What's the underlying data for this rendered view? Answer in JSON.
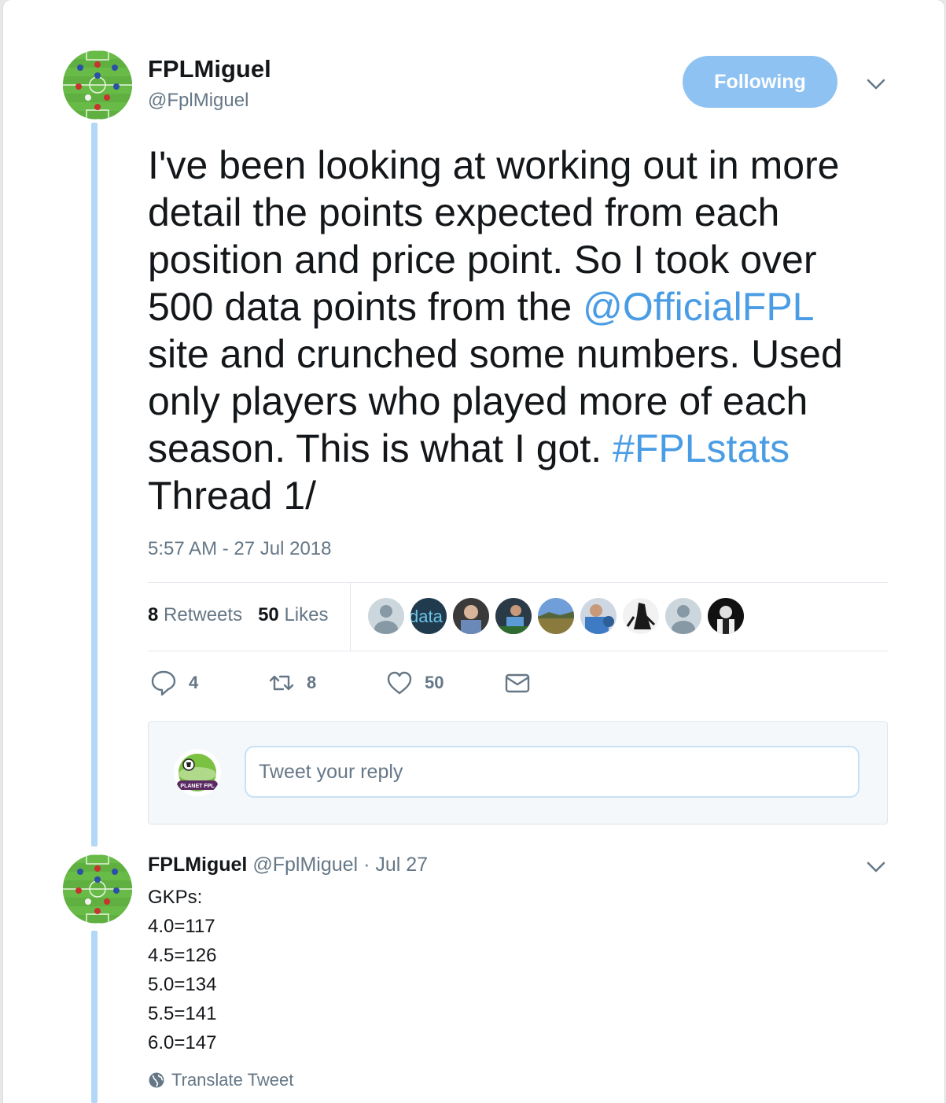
{
  "tweet": {
    "author_name": "FPLMiguel",
    "author_handle": "@FplMiguel",
    "follow_label": "Following",
    "text_lines": [
      [
        {
          "t": "I've been looking at working out in more"
        }
      ],
      [
        {
          "t": "detail the points expected from each"
        }
      ],
      [
        {
          "t": "position and price point. So I took over"
        }
      ],
      [
        {
          "t": "500 data points from the "
        },
        {
          "t": "@OfficialFPL",
          "link": true
        }
      ],
      [
        {
          "t": "site and crunched some numbers. Used"
        }
      ],
      [
        {
          "t": "only players who played more of each"
        }
      ],
      [
        {
          "t": "season. This is what I got. "
        },
        {
          "t": "#FPLstats",
          "link": true
        }
      ],
      [
        {
          "t": "Thread 1/"
        }
      ]
    ],
    "timestamp": "5:57 AM - 27 Jul 2018",
    "retweets_count": "8",
    "retweets_label": "Retweets",
    "likes_count": "50",
    "likes_label": "Likes",
    "liker_avatars": [
      "default",
      "data",
      "photo-person",
      "football-player",
      "landscape",
      "player-blue",
      "bw-figure",
      "default",
      "portrait-bw"
    ],
    "actions": {
      "reply_count": "4",
      "retweet_count": "8",
      "like_count": "50"
    },
    "reply_placeholder": "Tweet your reply"
  },
  "reply_tweet": {
    "author_name": "FPLMiguel",
    "author_handle": "@FplMiguel",
    "date": "· Jul 27",
    "lines": [
      "GKPs:",
      "4.0=117",
      "4.5=126",
      "5.0=134",
      "5.5=141",
      "6.0=147"
    ],
    "translate_label": "Translate Tweet"
  },
  "colors": {
    "link": "#4a9de4",
    "follow_button": "#8ec2f2",
    "thread_line": "#b3d8f7",
    "muted": "#657786"
  }
}
